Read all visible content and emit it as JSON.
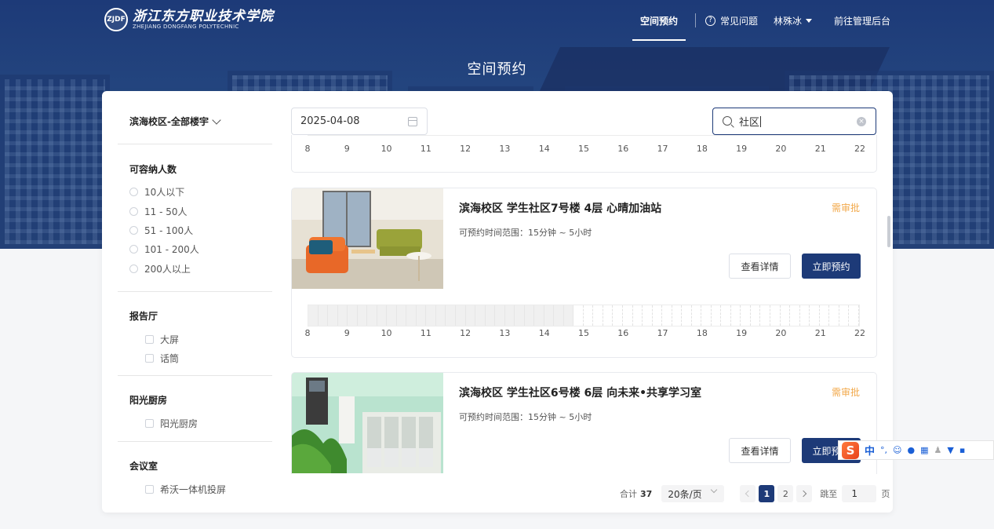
{
  "brand": {
    "seal_text": "ZJDF",
    "name_cn": "浙江东方职业技术学院",
    "name_en": "ZHEJIANG DONGFANG POLYTECHNIC"
  },
  "nav": {
    "active_tab": "空间预约",
    "faq": "常见问题",
    "user": "林殊冰",
    "admin": "前往管理后台"
  },
  "hero_title": "空间预约",
  "sidebar": {
    "campus": "滨海校区-全部楼宇",
    "capacity": {
      "title": "可容纳人数",
      "options": [
        "10人以下",
        "11 - 50人",
        "51 - 100人",
        "101 - 200人",
        "200人以上"
      ]
    },
    "report_hall": {
      "title": "报告厅",
      "options": [
        "大屏",
        "话筒"
      ]
    },
    "sunshine_kitchen": {
      "title": "阳光厨房",
      "options": [
        "阳光厨房"
      ]
    },
    "meeting_room": {
      "title": "会议室",
      "options": [
        "希沃一体机投屏"
      ]
    }
  },
  "filters": {
    "date": "2025-04-08",
    "search": "社区"
  },
  "timeline_hours": [
    "8",
    "9",
    "10",
    "11",
    "12",
    "13",
    "14",
    "15",
    "16",
    "17",
    "18",
    "19",
    "20",
    "21",
    "22"
  ],
  "rooms": [
    {
      "title": "滨海校区 学生社区7号楼 4层 心晴加油站",
      "range": "可预约时间范围：15分钟 ~ 5小时",
      "badge": "需审批",
      "detail_label": "查看详情",
      "book_label": "立即预约",
      "busy_until_fraction": 0.48
    },
    {
      "title": "滨海校区 学生社区6号楼 6层 向未来•共享学习室",
      "range": "可预约时间范围：15分钟 ~ 5小时",
      "badge": "需审批",
      "detail_label": "查看详情",
      "book_label": "立即预约"
    }
  ],
  "pagination": {
    "total_label": "合计",
    "total": "37",
    "page_size": "20条/页",
    "pages": [
      "1",
      "2"
    ],
    "current": "1",
    "jump_label": "跳至",
    "jump_value": "1",
    "page_unit": "页"
  },
  "ime": {
    "logo": "S",
    "lang": "中",
    "punct": "°,"
  },
  "colors": {
    "primary": "#1d3a78",
    "badge": "#f2a94b",
    "hero": "#24467f"
  }
}
